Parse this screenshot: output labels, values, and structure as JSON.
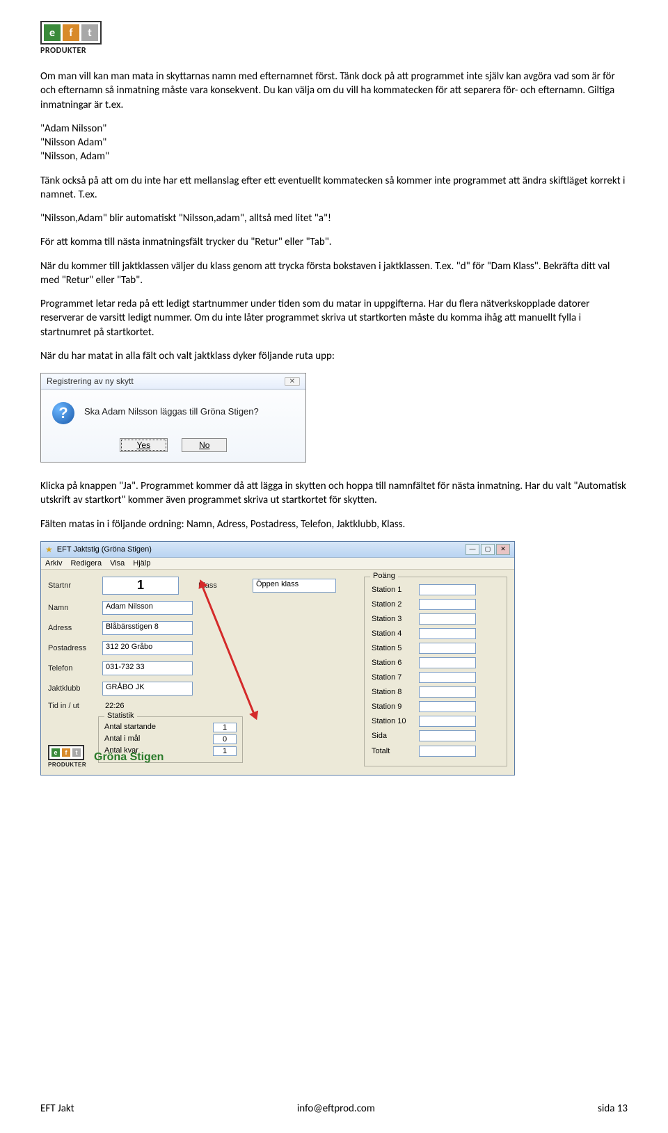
{
  "logo": {
    "letters": [
      "e",
      "f",
      "t"
    ],
    "brand": "PRODUKTER"
  },
  "p1": "Om man vill kan man mata in skyttarnas namn med efternamnet först. Tänk dock på att programmet inte själv kan avgöra vad som är för och efternamn så inmatning måste vara konsekvent. Du kan välja om du vill ha kommatecken för att separera för- och efternamn. Giltiga inmatningar är t.ex.",
  "examples": [
    "\"Adam Nilsson\"",
    "\"Nilsson Adam\"",
    "\"Nilsson, Adam\""
  ],
  "p2": "Tänk också på att om du inte har ett mellanslag efter ett eventuellt kommatecken så kommer inte programmet att ändra skiftläget korrekt i namnet. T.ex.",
  "p3": "\"Nilsson,Adam\" blir automatiskt \"Nilsson,adam\", alltså med litet \"a\"!",
  "p4": "För att komma till nästa inmatningsfält trycker du \"Retur\" eller \"Tab\".",
  "p5": "När du kommer till jaktklassen väljer du klass genom att trycka första bokstaven i jaktklassen. T.ex. \"d\" för \"Dam Klass\". Bekräfta ditt val med \"Retur\" eller \"Tab\".",
  "p6": "Programmet letar reda på ett ledigt startnummer under tiden som du matar in uppgifterna. Har du flera nätverkskopplade datorer reserverar de varsitt ledigt nummer. Om du inte låter programmet skriva ut startkorten måste du komma ihåg att manuellt fylla i startnumret på startkortet.",
  "p7": "När du har matat in alla fält och valt jaktklass dyker följande ruta upp:",
  "dialog": {
    "title": "Registrering av ny skytt",
    "message": "Ska Adam Nilsson läggas till Gröna Stigen?",
    "yes": "Yes",
    "no": "No"
  },
  "p8": "Klicka på knappen \"Ja\". Programmet kommer då att lägga in skytten och hoppa till namnfältet för nästa inmatning. Har du valt \"Automatisk utskrift av startkort\" kommer även programmet skriva ut startkortet för skytten.",
  "p9": "Fälten matas in i följande ordning: Namn, Adress, Postadress, Telefon, Jaktklubb, Klass.",
  "app": {
    "title": "EFT Jaktstig (Gröna Stigen)",
    "menu": [
      "Arkiv",
      "Redigera",
      "Visa",
      "Hjälp"
    ],
    "fields": {
      "startnr_label": "Startnr",
      "startnr": "1",
      "klass_label": "Klass",
      "klass": "Öppen klass",
      "namn_label": "Namn",
      "namn": "Adam Nilsson",
      "adress_label": "Adress",
      "adress": "Blåbärsstigen 8",
      "postadress_label": "Postadress",
      "postadress": "312 20 Gråbo",
      "telefon_label": "Telefon",
      "telefon": "031-732 33",
      "jaktklubb_label": "Jaktklubb",
      "jaktklubb": "GRÅBO JK",
      "tid_label": "Tid in / ut",
      "tid": "22:26"
    },
    "stat": {
      "legend": "Statistik",
      "antal_start_label": "Antal startande",
      "antal_start": "1",
      "antal_mal_label": "Antal i mål",
      "antal_mal": "0",
      "antal_kvar_label": "Antal kvar",
      "antal_kvar": "1"
    },
    "poang": {
      "legend": "Poäng",
      "stations": [
        "Station 1",
        "Station 2",
        "Station 3",
        "Station 4",
        "Station 5",
        "Station 6",
        "Station 7",
        "Station 8",
        "Station 9",
        "Station 10"
      ],
      "sida_label": "Sida",
      "totalt_label": "Totalt"
    },
    "brand": "Gröna Stigen"
  },
  "footer": {
    "left": "EFT Jakt",
    "center": "info@eftprod.com",
    "right": "sida 13"
  }
}
